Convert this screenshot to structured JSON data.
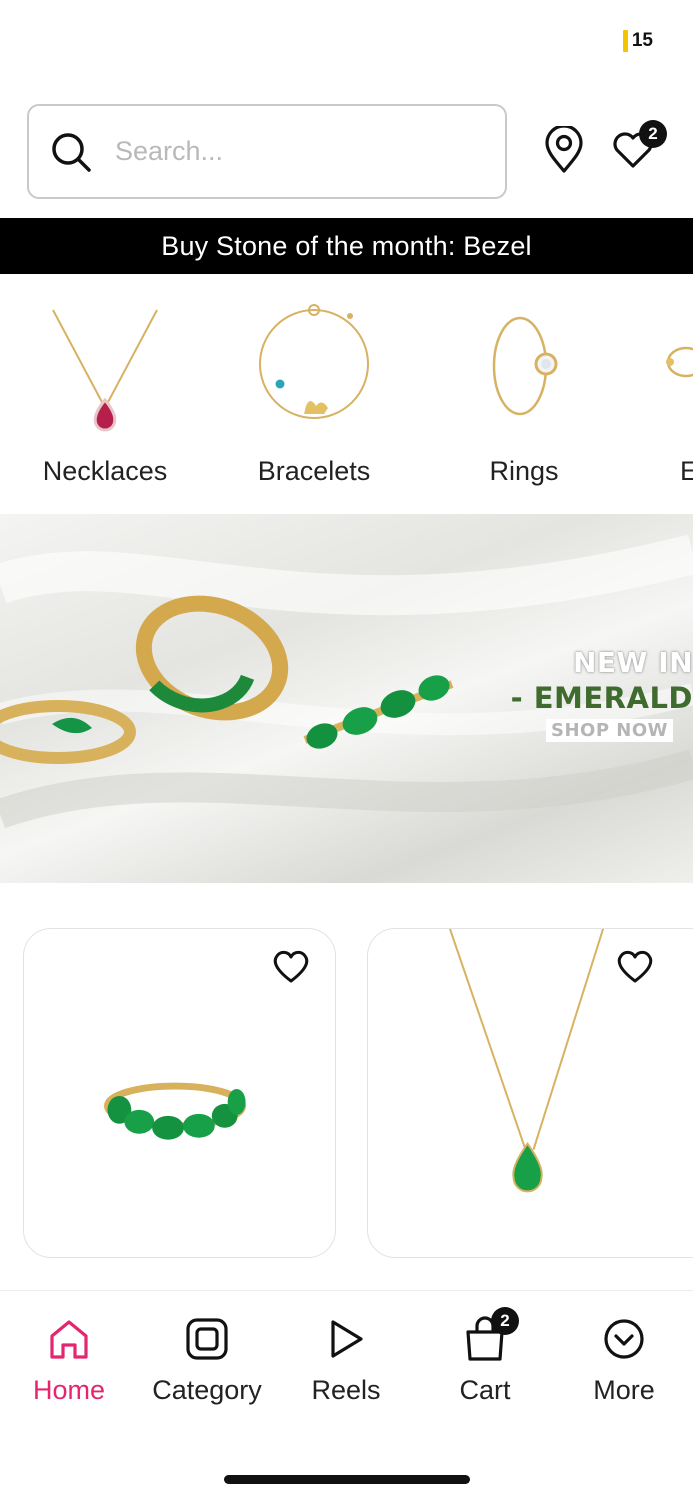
{
  "status_bar": {
    "battery": "15"
  },
  "header": {
    "search_placeholder": "Search...",
    "wishlist_count": "2",
    "icons": [
      "search-icon",
      "location-pin-icon",
      "wishlist-heart-icon"
    ]
  },
  "announcement": "Buy Stone of the month: Bezel",
  "categories": [
    {
      "label": "Necklaces"
    },
    {
      "label": "Bracelets"
    },
    {
      "label": "Rings"
    },
    {
      "label": "E"
    }
  ],
  "banner": {
    "line1": "NEW IN",
    "line2": "- EMERALD",
    "cta": "SHOP NOW"
  },
  "colors": {
    "accent": "#e3266f",
    "emerald": "#1f9a4a",
    "gold": "#d9b45a",
    "banner_green": "#3f6b2f"
  },
  "bottom_nav": {
    "items": [
      {
        "label": "Home",
        "icon": "home-icon"
      },
      {
        "label": "Category",
        "icon": "category-icon"
      },
      {
        "label": "Reels",
        "icon": "play-icon"
      },
      {
        "label": "Cart",
        "icon": "cart-bag-icon"
      },
      {
        "label": "More",
        "icon": "chevron-circle-icon"
      }
    ],
    "cart_count": "2",
    "active": "Home"
  }
}
